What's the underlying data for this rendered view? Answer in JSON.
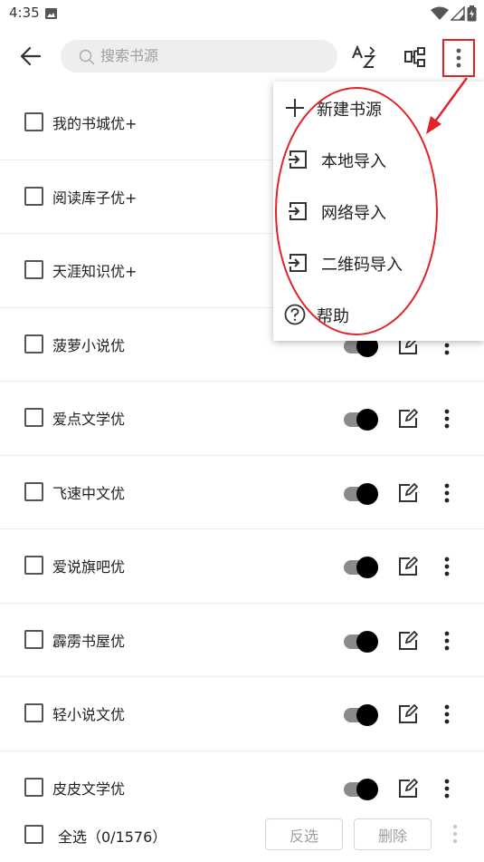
{
  "status": {
    "time": "4:35"
  },
  "toolbar": {
    "search_placeholder": "搜索书源",
    "sort_icon": "sort-az-icon",
    "group_icon": "group-icon",
    "more_icon": "more-vert-icon"
  },
  "sources": [
    {
      "name": "我的书城优+",
      "enabled": true
    },
    {
      "name": "阅读库子优+",
      "enabled": true
    },
    {
      "name": "天涯知识优+",
      "enabled": true
    },
    {
      "name": "菠萝小说优",
      "enabled": true
    },
    {
      "name": "爱点文学优",
      "enabled": true
    },
    {
      "name": "飞速中文优",
      "enabled": true
    },
    {
      "name": "爱说旗吧优",
      "enabled": true
    },
    {
      "name": "霹雳书屋优",
      "enabled": true
    },
    {
      "name": "轻小说文优",
      "enabled": true
    },
    {
      "name": "皮皮文学优",
      "enabled": true
    }
  ],
  "menu": {
    "items": [
      {
        "label": "新建书源",
        "icon": "add-icon"
      },
      {
        "label": "本地导入",
        "icon": "import-icon"
      },
      {
        "label": "网络导入",
        "icon": "import-icon"
      },
      {
        "label": "二维码导入",
        "icon": "import-icon"
      },
      {
        "label": "帮助",
        "icon": "help-icon"
      }
    ]
  },
  "bottom": {
    "select_all": "全选（0/1576）",
    "invert": "反选",
    "delete": "删除"
  },
  "colors": {
    "annotation": "#e0242a",
    "toggle_thumb": "#000000",
    "toggle_track": "#8a8a8a"
  }
}
